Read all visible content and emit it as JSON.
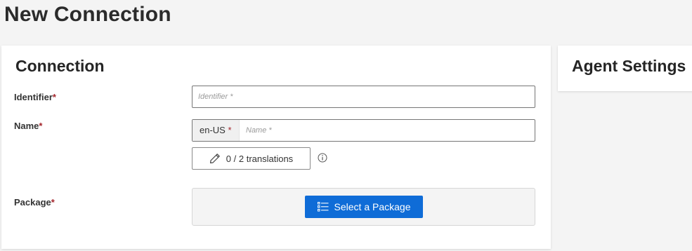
{
  "page": {
    "title": "New Connection"
  },
  "connection_card": {
    "title": "Connection",
    "fields": {
      "identifier": {
        "label": "Identifier",
        "required_mark": "*",
        "placeholder": "Identifier *"
      },
      "name": {
        "label": "Name",
        "required_mark": "*",
        "lang_code": "en-US",
        "lang_required_mark": "*",
        "placeholder": "Name *"
      },
      "package": {
        "label": "Package",
        "required_mark": "*"
      }
    },
    "translations_button": {
      "label": "0 / 2 translations",
      "icon": "pencil-icon"
    },
    "info_icon": "info-icon",
    "select_package_button": {
      "label": "Select a Package",
      "icon": "list-icon"
    }
  },
  "agent_card": {
    "title": "Agent Settings"
  },
  "colors": {
    "accent": "#0f6cd7",
    "required": "#a4262c",
    "page_bg": "#f4f4f4"
  }
}
